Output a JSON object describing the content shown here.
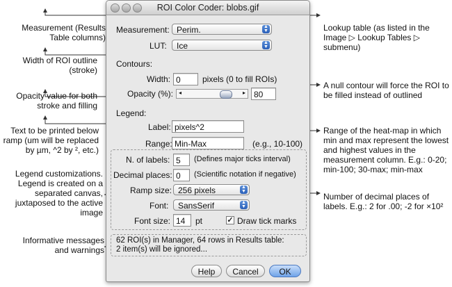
{
  "dialog": {
    "title": "ROI Color Coder: blobs.gif",
    "measurement": {
      "label": "Measurement:",
      "value": "Perim."
    },
    "lut": {
      "label": "LUT:",
      "value": "Ice"
    },
    "contours": {
      "heading": "Contours:",
      "width_label": "Width:",
      "width_value": "0",
      "width_hint": "pixels  (0 to fill ROIs)",
      "opacity_label": "Opacity (%):",
      "opacity_value": "80",
      "opacity_fraction": 0.8
    },
    "legend": {
      "heading": "Legend:",
      "label_label": "Label:",
      "label_value": "pixels^2",
      "range_label": "Range:",
      "range_value": "Min-Max",
      "range_hint": "(e.g., 10-100)",
      "nlabels_label": "N. of labels:",
      "nlabels_value": "5",
      "nlabels_hint": "(Defines major ticks interval)",
      "decimals_label": "Decimal places:",
      "decimals_value": "0",
      "decimals_hint": "(Scientific notation if negative)",
      "ramp_label": "Ramp size:",
      "ramp_value": "256 pixels",
      "font_label": "Font:",
      "font_value": "SansSerif",
      "fontsize_label": "Font size:",
      "fontsize_value": "14",
      "fontsize_unit": "pt",
      "ticks_label": "Draw tick marks",
      "ticks_checked": true
    },
    "messages": {
      "line1": "62 ROI(s) in Manager, 64 rows in Results table:",
      "line2": "2 item(s) will be ignored..."
    },
    "buttons": {
      "help": "Help",
      "cancel": "Cancel",
      "ok": "OK"
    }
  },
  "annotations": {
    "measurement": [
      "Measurement (Results",
      "Table columns)"
    ],
    "width": [
      "Width of ROI outline",
      "(stroke)"
    ],
    "opacity": [
      "Opacity value for both",
      "stroke and filling"
    ],
    "label": [
      "Text to be printed below",
      "ramp (um will be replaced",
      "by µm, ^2  by ², etc.)"
    ],
    "legend": [
      "Legend customizations.",
      "Legend is created on a",
      "separated canvas,",
      "juxtaposed to the active",
      "image"
    ],
    "messages": [
      "Informative messages",
      "and warnings"
    ],
    "lut": [
      "Lookup table (as listed in the",
      "Image ▷ Lookup Tables ▷",
      "submenu)"
    ],
    "null_contour": [
      "A null contour will force the ROI to",
      "be filled instead of outlined"
    ],
    "range": [
      "Range of the heat-map in which",
      "min and max represent the lowest",
      "and highest values in the",
      "measurement column. E.g.: 0-20;",
      "min-100; 30-max; min-max"
    ],
    "decimals": [
      "Number of decimal places of",
      "labels. E.g.: 2 for .00; -2 for ×10²"
    ]
  }
}
